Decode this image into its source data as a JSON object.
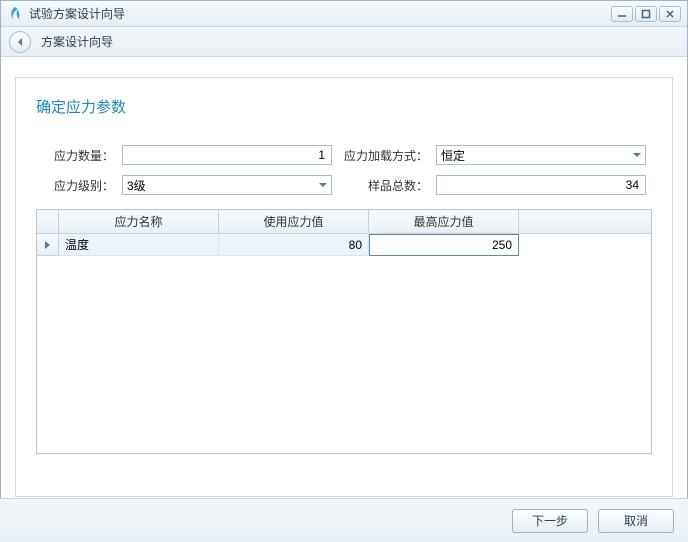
{
  "window": {
    "title": "试验方案设计向导"
  },
  "breadcrumb": {
    "text": "方案设计向导"
  },
  "section": {
    "title": "确定应力参数"
  },
  "form": {
    "stress_count_label": "应力数量：",
    "stress_count_value": "1",
    "load_mode_label": "应力加载方式：",
    "load_mode_value": "恒定",
    "stress_level_label": "应力级别：",
    "stress_level_value": "3级",
    "sample_total_label": "样品总数：",
    "sample_total_value": "34"
  },
  "grid": {
    "columns": {
      "c1": "应力名称",
      "c2": "使用应力值",
      "c3": "最高应力值"
    },
    "rows": [
      {
        "name": "温度",
        "use_value": "80",
        "max_value": "250"
      }
    ]
  },
  "footer": {
    "next": "下一步",
    "cancel": "取消"
  }
}
